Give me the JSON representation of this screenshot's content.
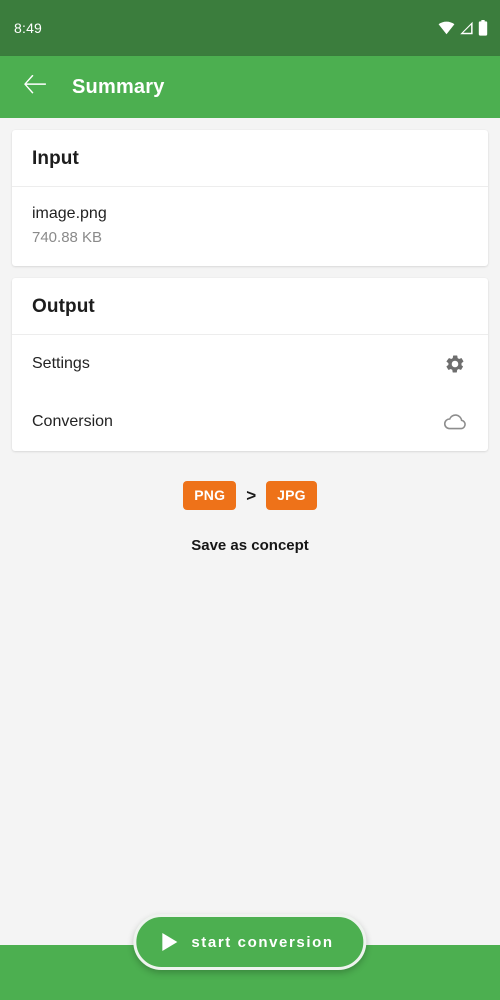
{
  "status_bar": {
    "time": "8:49",
    "icons": [
      "wifi-icon",
      "cellular-signal-icon",
      "battery-icon"
    ],
    "background_color": "#3b7d3d"
  },
  "app_bar": {
    "back_icon": "back-arrow-icon",
    "title": "Summary",
    "background_color": "#4caf50"
  },
  "input_card": {
    "header": "Input",
    "file_name": "image.png",
    "file_size": "740.88 KB"
  },
  "output_card": {
    "header": "Output",
    "rows": [
      {
        "label": "Settings",
        "icon": "gear-icon"
      },
      {
        "label": "Conversion",
        "icon": "cloud-icon"
      }
    ]
  },
  "formats": {
    "source": "PNG",
    "separator": ">",
    "target": "JPG",
    "badge_color": "#ee7219"
  },
  "save_concept": {
    "label": "Save as concept"
  },
  "fab": {
    "label": "start conversion",
    "icon": "play-icon",
    "background_color": "#4caf50"
  }
}
